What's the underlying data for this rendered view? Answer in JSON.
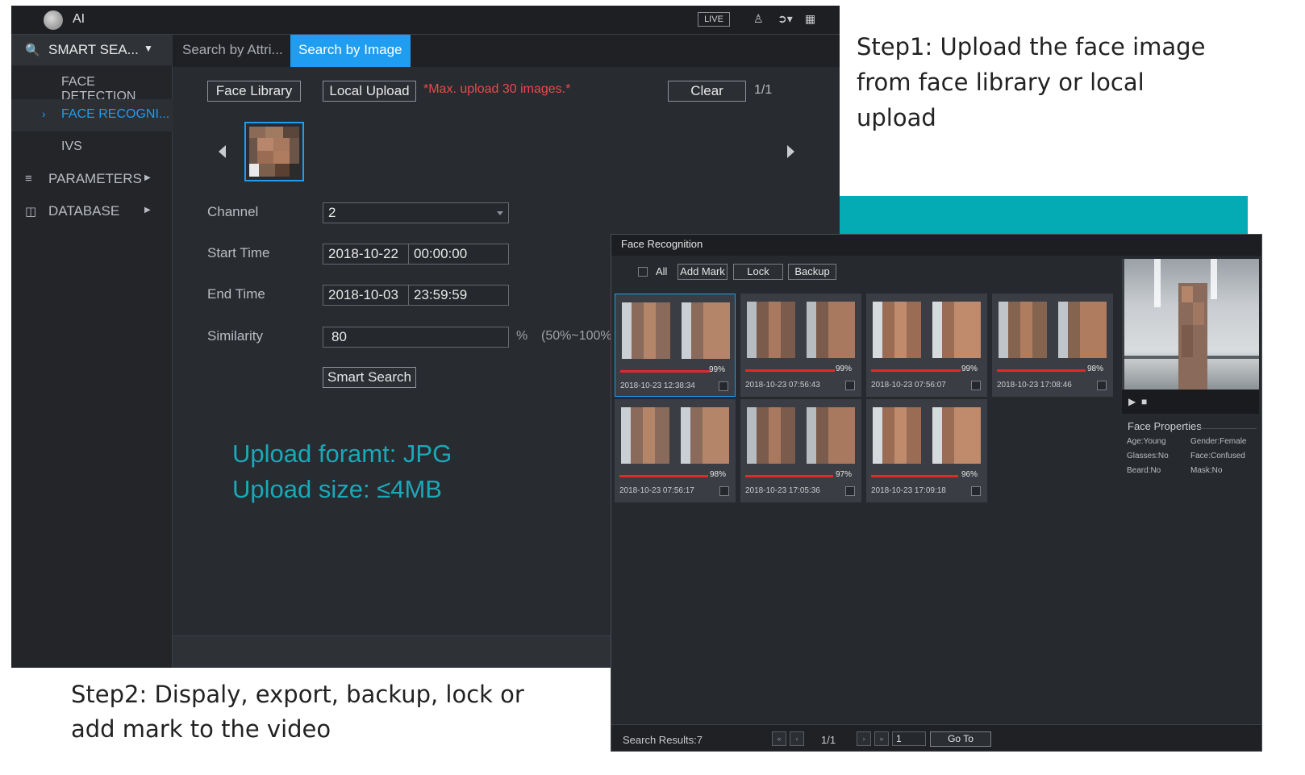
{
  "app": {
    "title": "AI",
    "live_label": "LIVE",
    "icons": [
      "user-icon",
      "logout-icon",
      "qr-icon"
    ]
  },
  "sidebar": {
    "header": {
      "label": "SMART SEA...",
      "icon": "search-person-icon"
    },
    "items": [
      {
        "label": "FACE DETECTION"
      },
      {
        "label": "FACE RECOGNI...",
        "active": true
      },
      {
        "label": "IVS"
      }
    ],
    "sections": [
      {
        "label": "PARAMETERS",
        "icon": "list-icon"
      },
      {
        "label": "DATABASE",
        "icon": "database-icon"
      }
    ]
  },
  "tabs": [
    {
      "label": "Search by Attri..."
    },
    {
      "label": "Search by Image",
      "active": true
    }
  ],
  "upload": {
    "face_library": "Face Library",
    "local_upload": "Local Upload",
    "warning": "*Max. upload 30 images.*",
    "clear": "Clear",
    "page": "1/1"
  },
  "form": {
    "channel_label": "Channel",
    "channel_value": "2",
    "start_label": "Start Time",
    "start_date": "2018-10-22",
    "start_time": "00:00:00",
    "end_label": "End Time",
    "end_date": "2018-10-03",
    "end_time": "23:59:59",
    "similarity_label": "Similarity",
    "similarity_value": "80",
    "similarity_unit": "%",
    "similarity_range": "(50%~100%",
    "smart_search": "Smart Search"
  },
  "upload_info": {
    "format": "Upload foramt: JPG",
    "size": "Upload size: ≤4MB"
  },
  "annotations": {
    "step1_line1": "Step1:  Upload the face image",
    "step1_line2": "from face library or local",
    "step1_line3": "upload",
    "step2_line1": "Step2:  Dispaly, export, backup, lock or",
    "step2_line2": "add mark to the video"
  },
  "face_recognition": {
    "title": "Face Recognition",
    "all_label": "All",
    "add_mark": "Add Mark",
    "lock": "Lock",
    "backup": "Backup",
    "results": [
      {
        "pct": "99%",
        "similarity": 0.99,
        "time": "2018-10-23 12:38:34"
      },
      {
        "pct": "99%",
        "similarity": 0.99,
        "time": "2018-10-23 07:56:43"
      },
      {
        "pct": "99%",
        "similarity": 0.99,
        "time": "2018-10-23 07:56:07"
      },
      {
        "pct": "98%",
        "similarity": 0.98,
        "time": "2018-10-23 17:08:46"
      },
      {
        "pct": "98%",
        "similarity": 0.98,
        "time": "2018-10-23 07:56:17"
      },
      {
        "pct": "97%",
        "similarity": 0.97,
        "time": "2018-10-23 17:05:36"
      },
      {
        "pct": "96%",
        "similarity": 0.96,
        "time": "2018-10-23 17:09:18"
      }
    ],
    "properties_title": "Face Properties",
    "properties": {
      "age": "Age:Young",
      "gender": "Gender:Female",
      "glasses": "Glasses:No",
      "face": "Face:Confused",
      "beard": "Beard:No",
      "mask": "Mask:No"
    },
    "footer": {
      "results": "Search Results:7",
      "page": "1/1",
      "page_input": "1",
      "goto": "Go To"
    }
  },
  "colors": {
    "accent": "#1e9df1",
    "warning": "#e84b4b",
    "teal": "#19a9b8",
    "similarity_bar": "#e02a2a"
  }
}
